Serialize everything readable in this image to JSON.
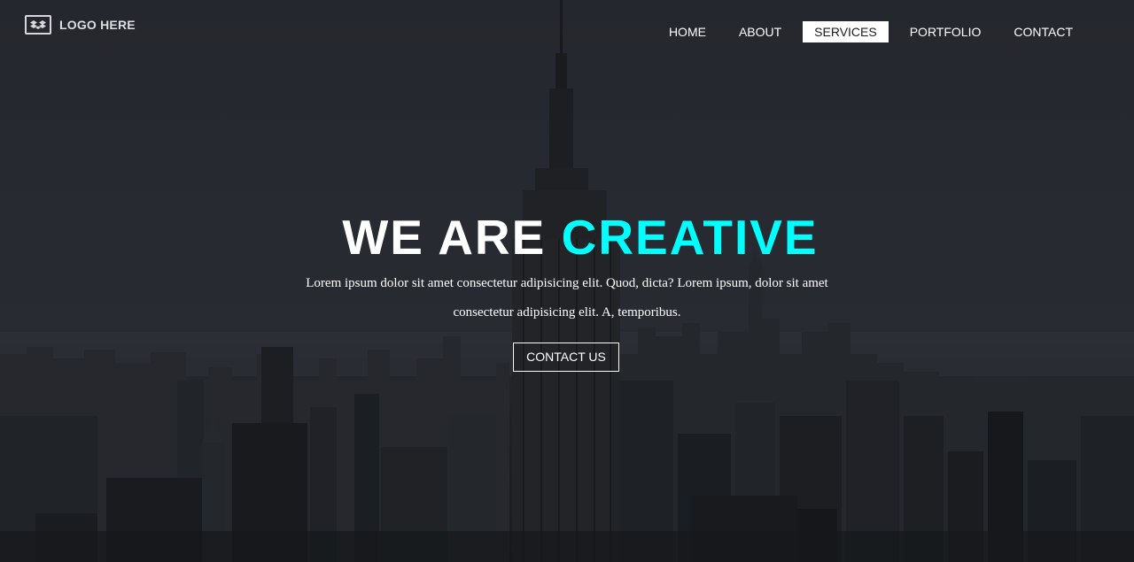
{
  "header": {
    "logo_icon": "dropbox-box-icon",
    "logo_text": "LOGO HERE"
  },
  "nav": {
    "items": [
      {
        "label": "HOME"
      },
      {
        "label": "ABOUT"
      },
      {
        "label": "SERVICES",
        "active": true
      },
      {
        "label": "PORTFOLIO"
      },
      {
        "label": "CONTACT"
      }
    ]
  },
  "hero": {
    "headline_white": "WE ARE",
    "headline_accent": "CREATIVE",
    "subtext_line1": "Lorem ipsum dolor sit amet consectetur adipisicing elit. Quod, dicta? Lorem ipsum, dolor sit amet",
    "subtext_line2": "consectetur adipisicing elit. A, temporibus.",
    "cta_label": "CONTACT US",
    "background": "city-skyline-photo"
  },
  "colors": {
    "accent": "#00ffff",
    "text": "#ffffff",
    "active_nav_bg": "#ffffff",
    "background": "#2b2d35"
  }
}
